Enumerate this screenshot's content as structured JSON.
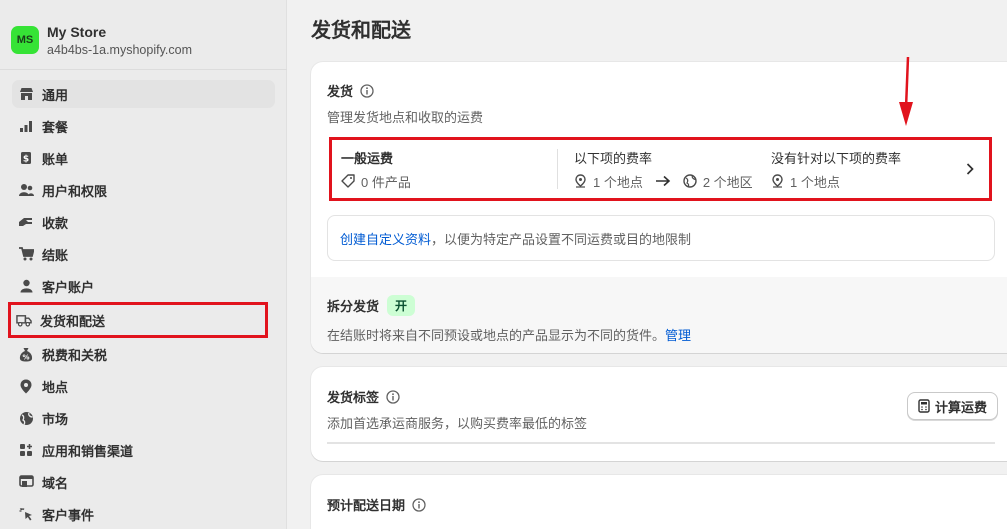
{
  "store": {
    "initials": "MS",
    "name": "My Store",
    "domain": "a4b4bs-1a.myshopify.com"
  },
  "nav": [
    {
      "label": "通用",
      "icon": "store-icon",
      "active": true
    },
    {
      "label": "套餐",
      "icon": "plan-icon"
    },
    {
      "label": "账单",
      "icon": "billing-icon"
    },
    {
      "label": "用户和权限",
      "icon": "users-icon"
    },
    {
      "label": "收款",
      "icon": "payments-icon"
    },
    {
      "label": "结账",
      "icon": "cart-icon"
    },
    {
      "label": "客户账户",
      "icon": "person-icon"
    },
    {
      "label": "发货和配送",
      "icon": "truck-icon"
    },
    {
      "label": "税费和关税",
      "icon": "tax-icon"
    },
    {
      "label": "地点",
      "icon": "location-icon"
    },
    {
      "label": "市场",
      "icon": "globe-icon"
    },
    {
      "label": "应用和销售渠道",
      "icon": "apps-icon"
    },
    {
      "label": "域名",
      "icon": "domain-icon"
    },
    {
      "label": "客户事件",
      "icon": "cursor-icon"
    }
  ],
  "page": {
    "title": "发货和配送"
  },
  "shipping": {
    "title": "发货",
    "subtitle": "管理发货地点和收取的运费",
    "profile": {
      "general_title": "一般运费",
      "products": "0 件产品",
      "rates_title": "以下项的费率",
      "from_locations": "1 个地点",
      "to_zones": "2 个地区",
      "no_rates_title": "没有针对以下项的费率",
      "no_rate_locations": "1 个地点"
    },
    "hint_link": "创建自定义资料",
    "hint_text": "，以便为特定产品设置不同运费或目的地限制",
    "split": {
      "title": "拆分发货",
      "badge": "开",
      "desc": "在结账时将来自不同预设或地点的产品显示为不同的货件。",
      "manage": "管理"
    }
  },
  "labels": {
    "title": "发货标签",
    "subtitle": "添加首选承运商服务，以购买费率最低的标签",
    "calc_button": "计算运费"
  },
  "delivery": {
    "title": "预计配送日期"
  },
  "colors": {
    "highlight": "#e1131d",
    "link": "#005bd3",
    "badge_bg": "#cdfed4"
  }
}
